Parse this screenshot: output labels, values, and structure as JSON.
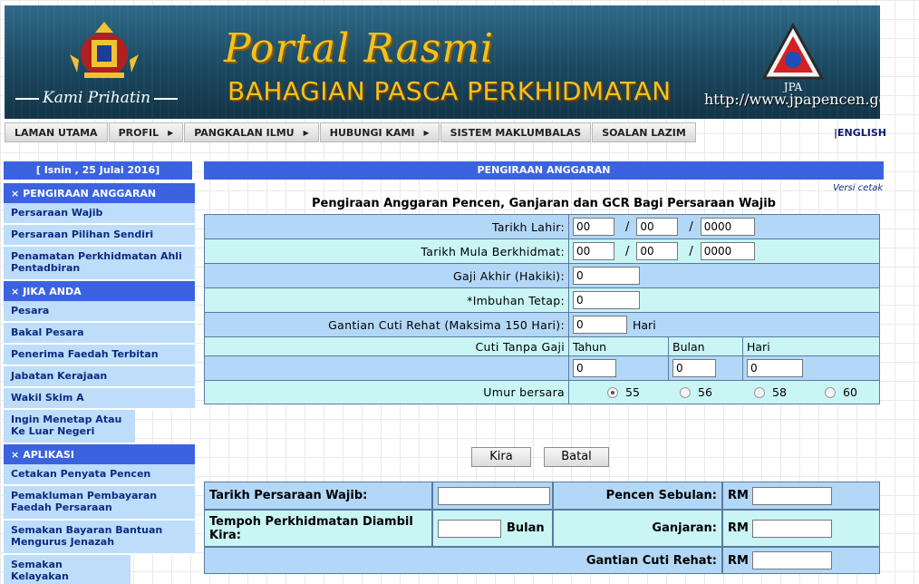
{
  "banner": {
    "portal_title": "Portal Rasmi",
    "department": "BAHAGIAN PASCA PERKHIDMATAN",
    "slogan": "Kami Prihatin",
    "url": "http://www.jpapencen.gov.my",
    "jpa_logo_text": "JPA",
    "colors": {
      "banner": "#1b4860",
      "title": "#f2c21b"
    }
  },
  "nav": {
    "items": [
      {
        "label": "LAMAN UTAMA",
        "has_submenu": false
      },
      {
        "label": "PROFIL",
        "has_submenu": true
      },
      {
        "label": "PANGKALAN ILMU",
        "has_submenu": true
      },
      {
        "label": "HUBUNGI KAMI",
        "has_submenu": true
      },
      {
        "label": "SISTEM MAKLUMBALAS",
        "has_submenu": false
      },
      {
        "label": "SOALAN LAZIM",
        "has_submenu": false
      }
    ],
    "submenu_icon": "triangle-right-icon",
    "lang_link": "|ENGLISH"
  },
  "sidebar": {
    "date": "[ Isnin , 25 Julai 2016]",
    "sections": [
      {
        "heading": "PENGIRAAN ANGGARAN",
        "items": [
          "Persaraan Wajib",
          "Persaraan Pilihan Sendiri",
          "Penamatan Perkhidmatan Ahli Pentadbiran"
        ]
      },
      {
        "heading": "JIKA ANDA",
        "items": [
          "Pesara",
          "Bakal Pesara",
          "Penerima Faedah Terbitan",
          "Jabatan Kerajaan",
          "Wakil Skim A",
          "Ingin Menetap Atau Ke Luar Negeri"
        ]
      },
      {
        "heading": "APLIKASI",
        "items": [
          "Cetakan Penyata Pencen",
          "Pemakluman Pembayaran Faedah Persaraan",
          "Semakan Bayaran Bantuan Mengurus Jenazah",
          "Semakan Kelayakan Perubatan eMASS"
        ]
      }
    ],
    "heading_icon": "cross-icon",
    "colors": {
      "heading": "#3b63e0",
      "item": "#bdddfb"
    }
  },
  "main": {
    "header": "PENGIRAAN ANGGARAN",
    "print_link": "Versi cetak",
    "form_title": "Pengiraan Anggaran Pencen, Ganjaran dan GCR Bagi Persaraan Wajib",
    "form": {
      "tarikh_lahir": {
        "label": "Tarikh Lahir:",
        "dd": "00",
        "mm": "00",
        "yyyy": "0000"
      },
      "tarikh_mula": {
        "label": "Tarikh Mula Berkhidmat:",
        "dd": "00",
        "mm": "00",
        "yyyy": "0000"
      },
      "gaji_akhir": {
        "label": "Gaji Akhir (Hakiki):",
        "value": "0"
      },
      "imbuhan": {
        "label": "*Imbuhan Tetap:",
        "value": "0"
      },
      "gcr": {
        "label": "Gantian Cuti Rehat (Maksima 150 Hari):",
        "value": "0",
        "unit": "Hari"
      },
      "cuti_tanpa_gaji": {
        "label": "Cuti Tanpa Gaji",
        "tahun_label": "Tahun",
        "bulan_label": "Bulan",
        "hari_label": "Hari",
        "tahun": "0",
        "bulan": "0",
        "hari": "0"
      },
      "umur": {
        "label": "Umur bersara",
        "options": [
          "55",
          "56",
          "58",
          "60"
        ],
        "selected": "55"
      },
      "slash": "/"
    },
    "buttons": {
      "kira": "Kira",
      "batal": "Batal"
    },
    "results": {
      "tarikh_persaraan_label": "Tarikh Persaraan Wajib:",
      "tarikh_persaraan": "",
      "pencen_label": "Pencen Sebulan:",
      "pencen": "",
      "tempoh_label": "Tempoh Perkhidmatan Diambil Kira:",
      "tempoh": "",
      "tempoh_unit": "Bulan",
      "ganjaran_label": "Ganjaran:",
      "ganjaran": "",
      "gcr_label": "Gantian Cuti Rehat:",
      "gcr": "",
      "currency": "RM"
    },
    "colors": {
      "row_a": "#b3d8f7",
      "row_b": "#c9f5f5",
      "header": "#3b63e0"
    }
  }
}
